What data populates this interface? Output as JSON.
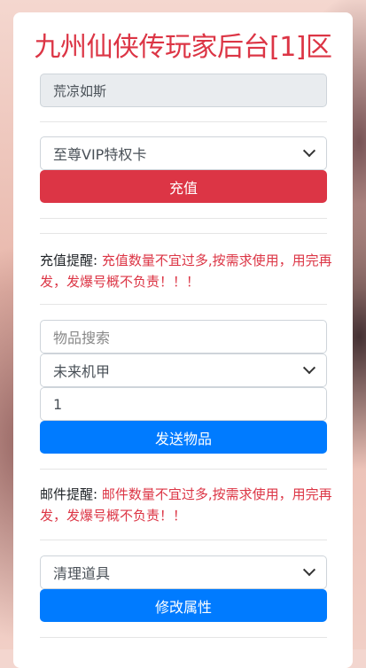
{
  "header": {
    "title": "九州仙侠传玩家后台[1]区"
  },
  "account": {
    "name": "荒凉如斯"
  },
  "recharge": {
    "select_value": "至尊VIP特权卡",
    "button_label": "充值"
  },
  "recharge_notice": {
    "label": "充值提醒: ",
    "text": "充值数量不宜过多,按需求使用，用完再发，发爆号概不负责！！！"
  },
  "send_item": {
    "search_placeholder": "物品搜索",
    "select_value": "未来机甲",
    "quantity": "1",
    "button_label": "发送物品"
  },
  "mail_notice": {
    "label": "邮件提醒: ",
    "text": "邮件数量不宜过多,按需求使用，用完再发，发爆号概不负责！！"
  },
  "modify": {
    "select_value": "清理道具",
    "button_label": "修改属性"
  },
  "colors": {
    "danger": "#dc3545",
    "primary": "#007bff"
  }
}
